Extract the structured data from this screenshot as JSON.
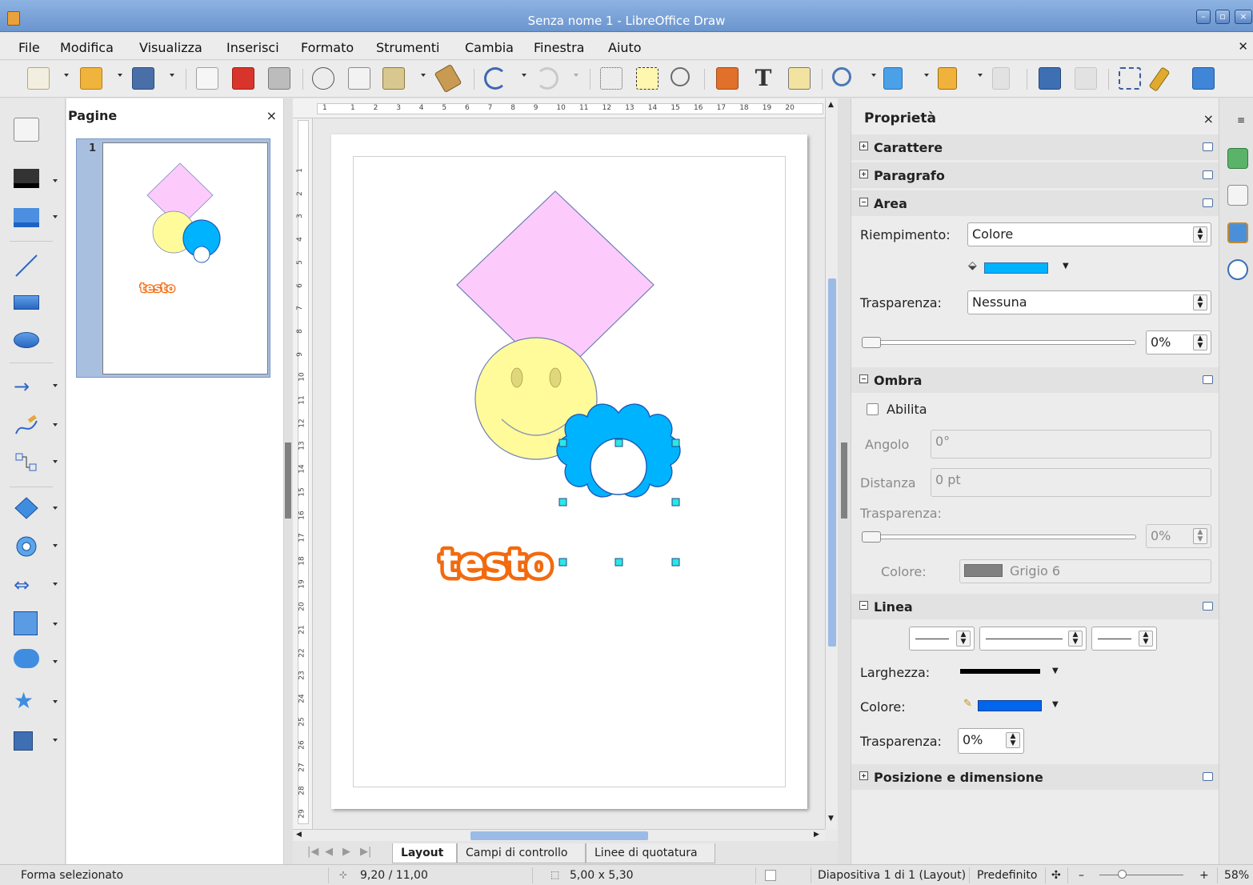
{
  "window": {
    "title": "Senza nome 1 - LibreOffice Draw"
  },
  "menu": [
    "File",
    "Modifica",
    "Visualizza",
    "Inserisci",
    "Formato",
    "Strumenti",
    "Cambia",
    "Finestra",
    "Aiuto"
  ],
  "pages_panel": {
    "title": "Pagine",
    "close": "×",
    "thumb_number": "1",
    "thumb_text": "testo"
  },
  "ruler": {
    "h_ticks": [
      "1",
      "1",
      "2",
      "3",
      "4",
      "5",
      "6",
      "7",
      "8",
      "9",
      "10",
      "11",
      "12",
      "13",
      "14",
      "15",
      "16",
      "17",
      "18",
      "19",
      "20"
    ],
    "v_ticks": [
      "1",
      "2",
      "3",
      "4",
      "5",
      "6",
      "7",
      "8",
      "9",
      "10",
      "11",
      "12",
      "13",
      "14",
      "15",
      "16",
      "17",
      "18",
      "19",
      "20",
      "21",
      "22",
      "23",
      "24",
      "25",
      "26",
      "27",
      "28",
      "29"
    ]
  },
  "canvas": {
    "text_object": "testo",
    "colors": {
      "diamond": "#fccbfc",
      "smiley": "#fffb9a",
      "flower": "#00b3ff",
      "testo_fill": "#ffffff",
      "testo_outline": "#f26a0f"
    }
  },
  "sheet_tabs": [
    "Layout",
    "Campi di controllo",
    "Linee di quotatura"
  ],
  "properties": {
    "title": "Proprietà",
    "close": "×",
    "sections": {
      "carattere": "Carattere",
      "paragrafo": "Paragrafo",
      "area": "Area",
      "ombra": "Ombra",
      "linea": "Linea",
      "posizione": "Posizione e dimensione"
    },
    "area": {
      "fill_label": "Riempimento:",
      "fill_value": "Colore",
      "fill_color": "#00b3ff",
      "transparency_label": "Trasparenza:",
      "transparency_value": "Nessuna",
      "transparency_percent": "0%"
    },
    "ombra": {
      "enable_label": "Abilita",
      "angle_label": "Angolo",
      "angle_value": "0°",
      "distance_label": "Distanza",
      "distance_value": "0 pt",
      "transparency_label": "Trasparenza:",
      "transparency_value": "0%",
      "color_label": "Colore:",
      "color_value": "Grigio 6",
      "color_swatch": "#808080"
    },
    "linea": {
      "width_label": "Larghezza:",
      "color_label": "Colore:",
      "line_color": "#0066ee",
      "transparency_label": "Trasparenza:",
      "transparency_value": "0%"
    }
  },
  "status": {
    "message": "Forma selezionato",
    "position": "9,20 / 11,00",
    "size": "5,00 x 5,30",
    "slide": "Diapositiva 1 di 1 (Layout)",
    "master": "Predefinito",
    "zoom": "58%",
    "zoom_minus": "–",
    "zoom_plus": "+"
  }
}
